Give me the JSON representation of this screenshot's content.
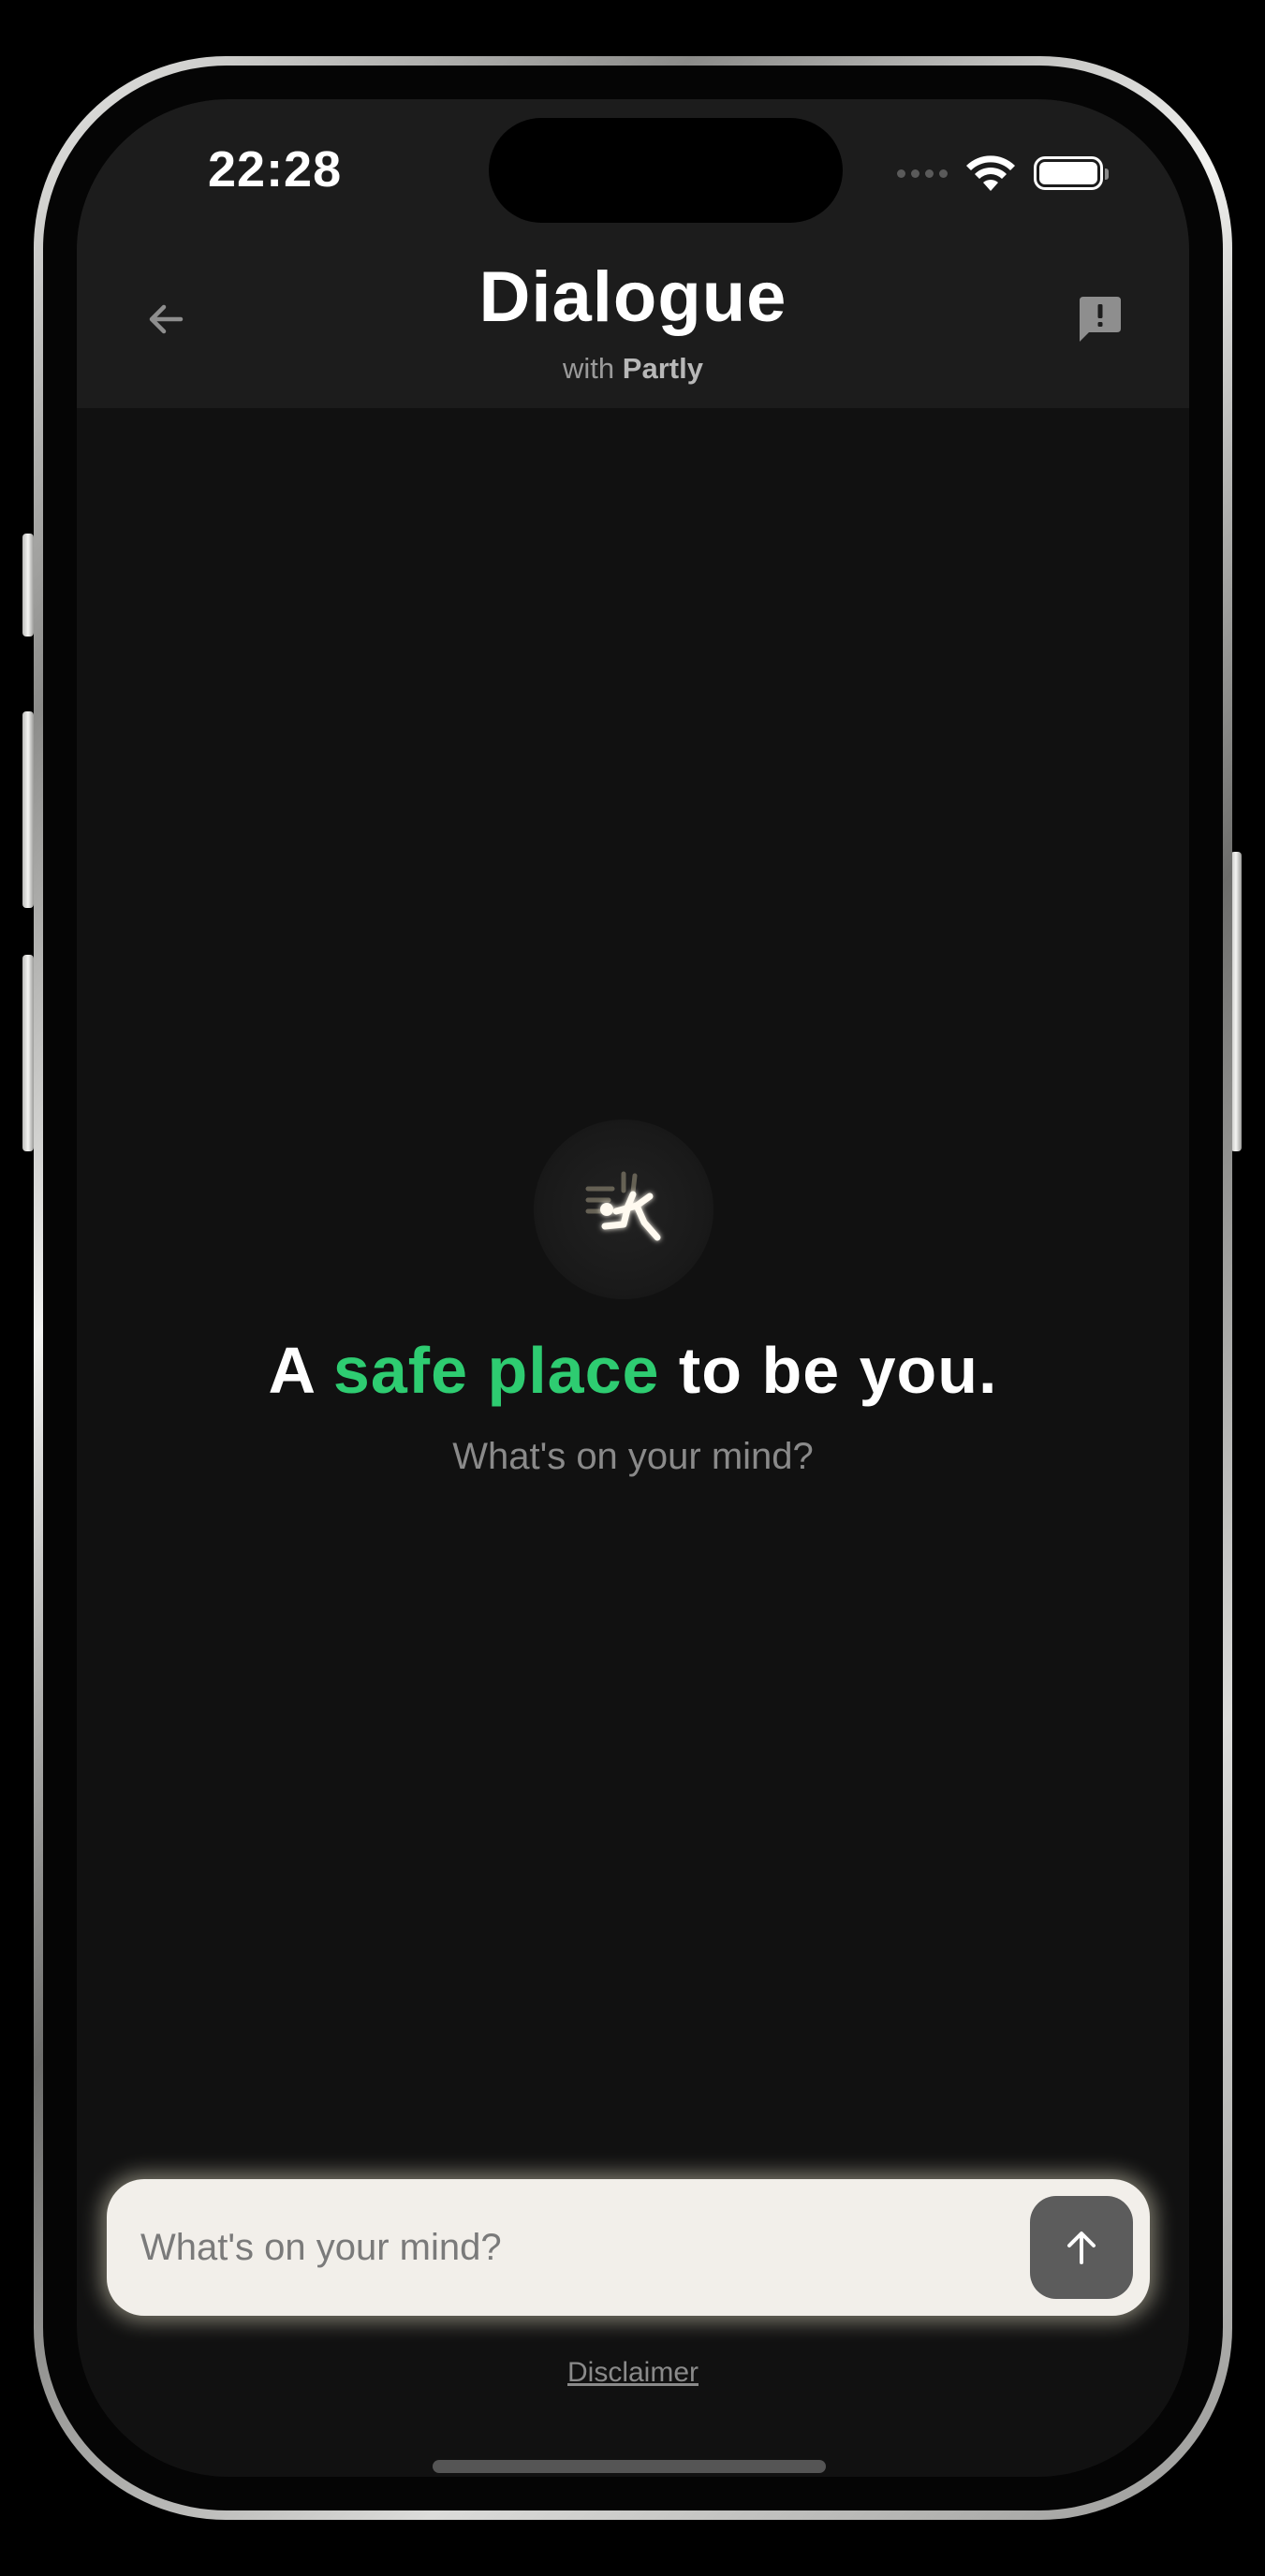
{
  "status_bar": {
    "time": "22:28"
  },
  "header": {
    "title": "Dialogue",
    "subtitle_prefix": "with",
    "subtitle_brand": "Partly"
  },
  "hero": {
    "heading_part1": "A ",
    "heading_accent": "safe place",
    "heading_part2": " to be you.",
    "subheading": "What's on your mind?"
  },
  "composer": {
    "placeholder": "What's on your mind?",
    "value": ""
  },
  "footer": {
    "disclaimer": "Disclaimer"
  },
  "colors": {
    "accent": "#2ecc71",
    "background": "#111111",
    "header": "#1c1c1c",
    "input_bg": "#f2efea",
    "send_button": "#5c5c5c"
  },
  "icons": {
    "back": "arrow-left-icon",
    "report": "report-message-icon",
    "logo": "falling-figure-logo",
    "send": "arrow-up-icon",
    "wifi": "wifi-icon",
    "battery": "battery-icon",
    "cellular": "cellular-signal-icon"
  }
}
